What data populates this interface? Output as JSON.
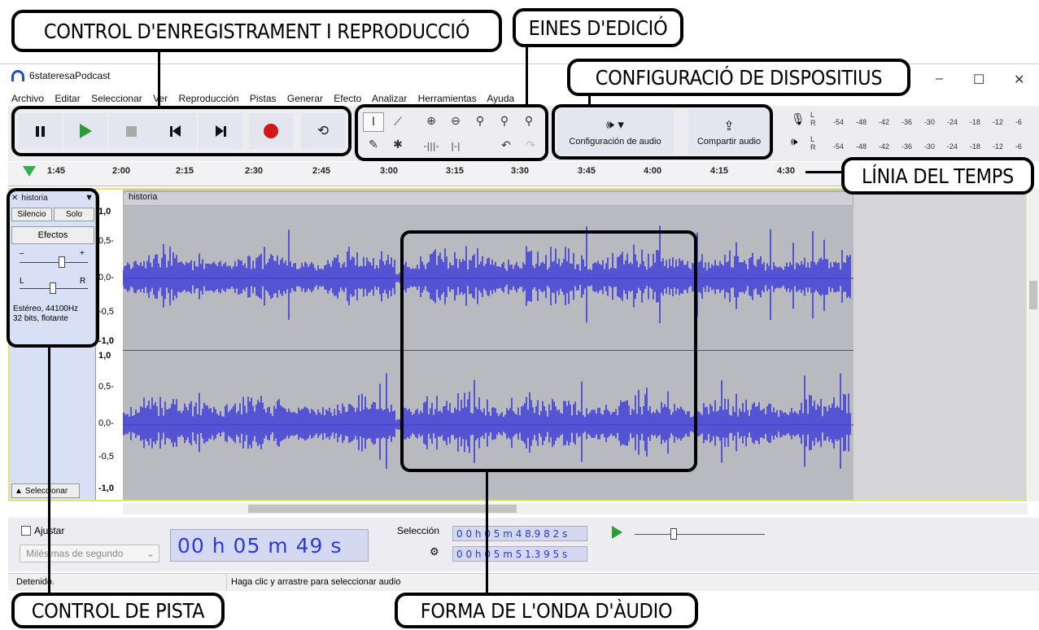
{
  "callouts": {
    "record_play": "CONTROL D'ENREGISTRAMENT I REPRODUCCIÓ",
    "edit_tools": "EINES D'EDICIÓ",
    "devices": "CONFIGURACIÓ DE DISPOSITIUS",
    "timeline": "LÍNIA DEL TEMPS",
    "track_control": "CONTROL DE PISTA",
    "waveform": "FORMA DE L'ONDA D'ÀUDIO"
  },
  "window": {
    "title": "6stateresaPodcast",
    "minimize": "–",
    "maximize": "☐",
    "close": "✕"
  },
  "menu": [
    "Archivo",
    "Editar",
    "Seleccionar",
    "Ver",
    "Reproducción",
    "Pistas",
    "Generar",
    "Efecto",
    "Analizar",
    "Herramientas",
    "Ayuda"
  ],
  "audio_setup": {
    "label": "Configuración de audio",
    "icon": "speaker-icon"
  },
  "share_audio": {
    "label": "Compartir audio",
    "icon": "upload-icon"
  },
  "meter_scale": [
    "-54",
    "-48",
    "-42",
    "-36",
    "-30",
    "-24",
    "-18",
    "-12",
    "-6"
  ],
  "meter_lr": [
    "L",
    "R"
  ],
  "timeline_ticks": [
    "1:45",
    "2:00",
    "2:15",
    "2:30",
    "2:45",
    "3:00",
    "3:15",
    "3:30",
    "3:45",
    "4:00",
    "4:15",
    "4:30"
  ],
  "track": {
    "name": "historia",
    "clip_name": "historia",
    "silence": "Silencio",
    "solo": "Solo",
    "effects": "Efectos",
    "gain_minus": "–",
    "gain_plus": "+",
    "pan_l": "L",
    "pan_r": "R",
    "info1": "Estéreo, 44100Hz",
    "info2": "32 bits, flotante",
    "select": "Seleccionar"
  },
  "amp_scale": [
    "1,0",
    "0,5-",
    "0,0-",
    "-0,5",
    "-1,0"
  ],
  "bottom": {
    "snap": "Ajustar",
    "unit": "Milésimas de segundo",
    "time": "00 h 05 m 49 s",
    "selection_label": "Selección",
    "sel_start": "0 0 h 0 5 m 4 8.9 8 2 s",
    "sel_end": "0 0 h 0 5 m 5 1.3 9 5 s"
  },
  "status": {
    "left": "Detenido.",
    "right": "Haga clic y arrastre para seleccionar audio"
  }
}
